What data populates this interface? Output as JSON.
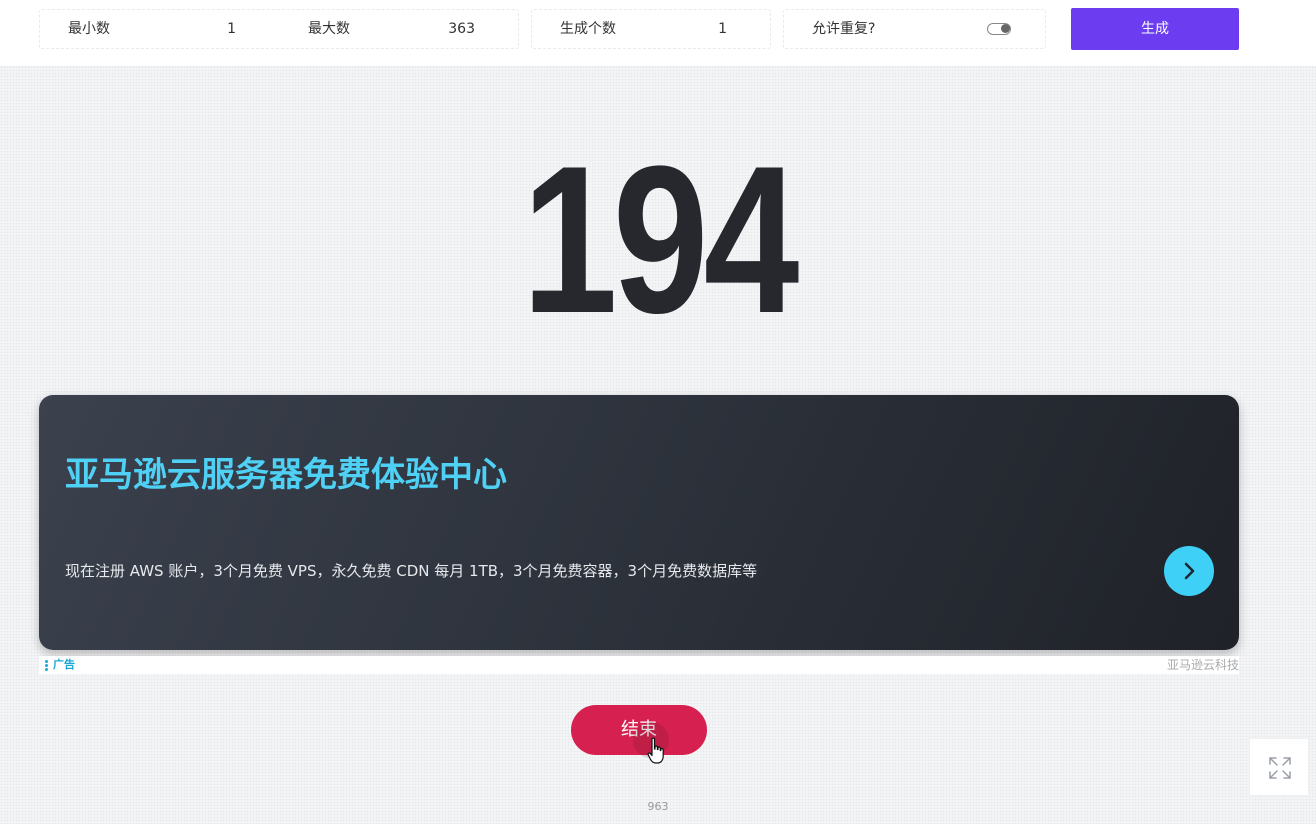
{
  "controls": {
    "min_label": "最小数",
    "min_value": "1",
    "max_label": "最大数",
    "max_value": "363",
    "count_label": "生成个数",
    "count_value": "1",
    "allow_repeat_label": "允许重复?",
    "allow_repeat_on": false,
    "generate_label": "生成"
  },
  "result": {
    "number": "194"
  },
  "ad": {
    "title": "亚马逊云服务器免费体验中心",
    "description": "现在注册 AWS 账户，3个月免费 VPS，永久免费 CDN 每月 1TB，3个月免费容器，3个月免费数据库等",
    "tag": "广告",
    "brand": "亚马逊云科技",
    "arrow_icon": "chevron-right-icon"
  },
  "end_button": {
    "label": "结束"
  },
  "footer": {
    "count": "963"
  },
  "colors": {
    "generate_button": "#6b3cf0",
    "end_button": "#d6204f",
    "ad_title": "#4fd0f5",
    "ad_arrow": "#3fd0f7"
  }
}
